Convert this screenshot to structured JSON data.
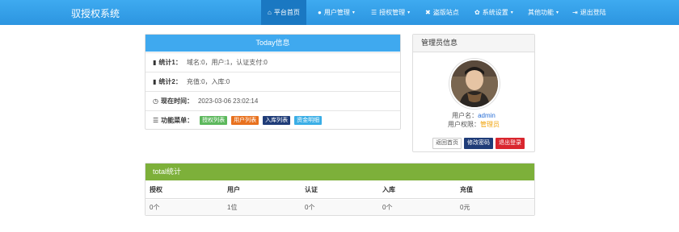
{
  "brand": "驭授权系统",
  "nav": [
    {
      "icon": "home-icon",
      "glyph": "⌂",
      "label": "平台首页",
      "caret": ""
    },
    {
      "icon": "user-icon",
      "glyph": "●",
      "label": "用户管理",
      "caret": "▾"
    },
    {
      "icon": "list-icon",
      "glyph": "☰",
      "label": "授权管理",
      "caret": "▾"
    },
    {
      "icon": "close-icon",
      "glyph": "✖",
      "label": "盗版站点",
      "caret": ""
    },
    {
      "icon": "gear-icon",
      "glyph": "✿",
      "label": "系统设置",
      "caret": "▾"
    },
    {
      "icon": "",
      "glyph": "",
      "label": "其他功能",
      "caret": "▾"
    },
    {
      "icon": "logout-icon",
      "glyph": "⇥",
      "label": "退出登陆",
      "caret": ""
    }
  ],
  "today": {
    "title": "Today信息",
    "stat1_label": "统计1：",
    "stat1_value": "域名:0，用户:1，认证支付:0",
    "stat2_label": "统计2：",
    "stat2_value": "充值:0，入库:0",
    "time_label": "现在时间：",
    "time_value": "2023-03-06 23:02:14",
    "menu_label": "功能菜单：",
    "menu_buttons": [
      {
        "label": "授权列表",
        "color": "#5cb85c"
      },
      {
        "label": "用户列表",
        "color": "#e8711e"
      },
      {
        "label": "入库列表",
        "color": "#1f3c78"
      },
      {
        "label": "资金明细",
        "color": "#3aaee6"
      }
    ]
  },
  "admin": {
    "title": "管理员信息",
    "username_label": "用户名：",
    "username": "admin",
    "perm_label": "用户权限：",
    "perm": "管理员",
    "buttons": [
      {
        "label": "返回首页",
        "bg": "#ffffff",
        "fg": "#555555"
      },
      {
        "label": "修改密码",
        "bg": "#1f3c78",
        "fg": "#ffffff"
      },
      {
        "label": "退出登录",
        "bg": "#d9262e",
        "fg": "#ffffff"
      }
    ]
  },
  "total": {
    "title": "total统计",
    "headers": [
      "授权",
      "用户",
      "认证",
      "入库",
      "充值"
    ],
    "values": [
      "0个",
      "1位",
      "0个",
      "0个",
      "0元"
    ]
  }
}
